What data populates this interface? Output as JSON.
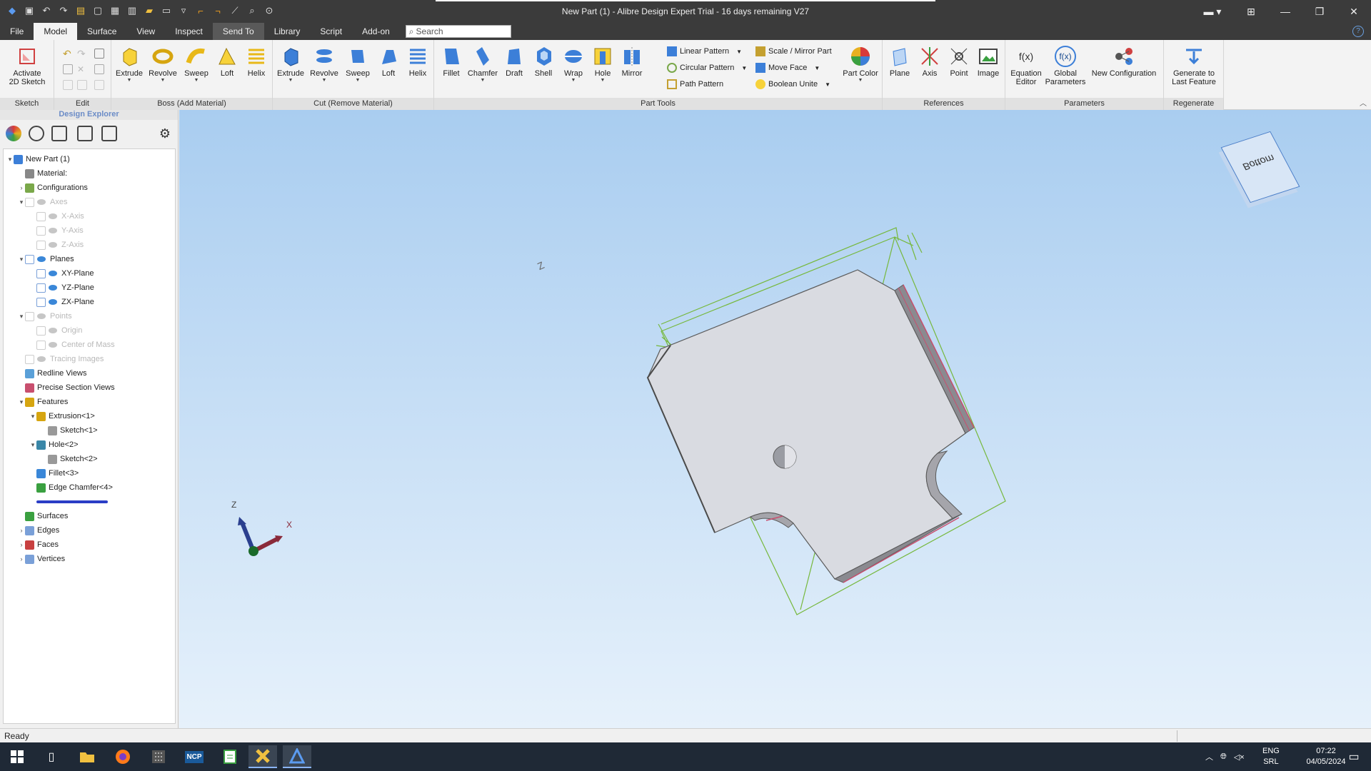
{
  "window": {
    "title": "New Part (1) - Alibre Design Expert  Trial - 16 days remaining V27"
  },
  "quick_access": [
    "app-logo-icon",
    "save-icon",
    "undo-icon",
    "redo-icon",
    "open-icon",
    "new-icon",
    "copy-icon",
    "paste-icon",
    "folder-icon",
    "window-icon",
    "window-dropdown-icon",
    "sketch-line-icon",
    "sketch-corner-icon",
    "measure-icon",
    "search-tool-icon",
    "zoom-icon"
  ],
  "menu": {
    "tabs": [
      "File",
      "Model",
      "Surface",
      "View",
      "Inspect",
      "Send To",
      "Library",
      "Script",
      "Add-on"
    ],
    "active": "Model",
    "hover": "Send To",
    "search_placeholder": "Search"
  },
  "ribbon": {
    "sketch": {
      "label": "Sketch",
      "button": "Activate\n2D Sketch"
    },
    "edit": {
      "label": "Edit"
    },
    "boss": {
      "label": "Boss (Add Material)",
      "buttons": [
        "Extrude",
        "Revolve",
        "Sweep",
        "Loft",
        "Helix"
      ]
    },
    "cut": {
      "label": "Cut (Remove Material)",
      "buttons": [
        "Extrude",
        "Revolve",
        "Sweep",
        "Loft",
        "Helix"
      ]
    },
    "part_tools": {
      "label": "Part Tools",
      "buttons": [
        "Fillet",
        "Chamfer",
        "Draft",
        "Shell",
        "Wrap",
        "Hole",
        "Mirror"
      ],
      "small": [
        "Linear Pattern",
        "Circular Pattern",
        "Path Pattern",
        "Scale / Mirror Part",
        "Move Face",
        "Boolean Unite"
      ],
      "part_color": "Part Color"
    },
    "references": {
      "label": "References",
      "buttons": [
        "Plane",
        "Axis",
        "Point",
        "Image"
      ]
    },
    "parameters": {
      "label": "Parameters",
      "buttons": [
        "Equation\nEditor",
        "Global\nParameters",
        "New Configuration"
      ]
    },
    "regenerate": {
      "label": "Regenerate",
      "button": "Generate to\nLast Feature"
    }
  },
  "explorer": {
    "title": "Design Explorer",
    "tree": [
      {
        "label": "New Part (1)",
        "level": 0
      },
      {
        "label": "Material:",
        "level": 1
      },
      {
        "label": "Configurations",
        "level": 1
      },
      {
        "label": "Axes",
        "level": 1,
        "dim": true
      },
      {
        "label": "X-Axis",
        "level": 2,
        "dim": true
      },
      {
        "label": "Y-Axis",
        "level": 2,
        "dim": true
      },
      {
        "label": "Z-Axis",
        "level": 2,
        "dim": true
      },
      {
        "label": "Planes",
        "level": 1
      },
      {
        "label": "XY-Plane",
        "level": 2
      },
      {
        "label": "YZ-Plane",
        "level": 2
      },
      {
        "label": "ZX-Plane",
        "level": 2
      },
      {
        "label": "Points",
        "level": 1,
        "dim": true
      },
      {
        "label": "Origin",
        "level": 2,
        "dim": true
      },
      {
        "label": "Center of Mass",
        "level": 2,
        "dim": true
      },
      {
        "label": "Tracing Images",
        "level": 1,
        "dim": true
      },
      {
        "label": "Redline Views",
        "level": 1
      },
      {
        "label": "Precise Section Views",
        "level": 1
      },
      {
        "label": "Features",
        "level": 1
      },
      {
        "label": "Extrusion<1>",
        "level": 2
      },
      {
        "label": "Sketch<1>",
        "level": 3
      },
      {
        "label": "Hole<2>",
        "level": 2
      },
      {
        "label": "Sketch<2>",
        "level": 3
      },
      {
        "label": "Fillet<3>",
        "level": 2
      },
      {
        "label": "Edge Chamfer<4>",
        "level": 2
      },
      {
        "label": "",
        "level": 2,
        "rollback": true
      },
      {
        "label": "Surfaces",
        "level": 1
      },
      {
        "label": "Edges",
        "level": 1
      },
      {
        "label": "Faces",
        "level": 1
      },
      {
        "label": "Vertices",
        "level": 1
      }
    ]
  },
  "viewport": {
    "view_cube_face": "Bottom",
    "axis_z": "Z",
    "axis_x": "X",
    "triad_z": "Z"
  },
  "status": {
    "text": "Ready"
  },
  "taskbar": {
    "apps": [
      "start-icon",
      "task-view-icon",
      "file-explorer-icon",
      "firefox-icon",
      "calculator-icon",
      "ncp-icon",
      "spreadsheet-icon",
      "xnview-icon",
      "alibre-icon"
    ],
    "ncp_label": "NCP",
    "lang": "ENG",
    "layout": "SRL",
    "time": "07:22",
    "date": "04/05/2024"
  },
  "colors": {
    "accent": "#2b64c6",
    "model_face": "#d9dbe1",
    "bbox_green": "#76b83c",
    "chamfer_edge": "#c84f6e"
  }
}
